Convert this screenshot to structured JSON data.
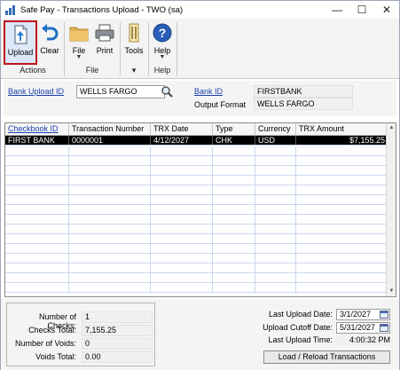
{
  "window": {
    "title": "Safe Pay - Transactions Upload  -  TWO (sa)",
    "minimize_glyph": "—",
    "maximize_glyph": "☐",
    "close_glyph": "✕"
  },
  "ribbon": {
    "upload_label": "Upload",
    "clear_label": "Clear",
    "file_label": "File",
    "print_label": "Print",
    "tools_label": "Tools",
    "help_label": "Help",
    "groups": {
      "actions": "Actions",
      "file": "File",
      "tools": "▾",
      "help": "Help"
    }
  },
  "header": {
    "bank_upload_id_label": "Bank Upload ID",
    "bank_upload_id_value": "WELLS FARGO",
    "bank_id_label": "Bank ID",
    "bank_id_value": "FIRSTBANK",
    "output_format_label": "Output Format",
    "output_format_value": "WELLS FARGO"
  },
  "grid": {
    "columns": [
      "Checkbook ID",
      "Transaction Number",
      "TRX Date",
      "Type",
      "Currency",
      "TRX Amount"
    ],
    "rows": [
      [
        "FIRST BANK",
        "0000001",
        "4/12/2027",
        "CHK",
        "USD",
        "$7,155.25"
      ]
    ]
  },
  "summary": {
    "number_of_checks_label": "Number of Checks:",
    "number_of_checks_value": "1",
    "checks_total_label": "Checks Total:",
    "checks_total_value": "7,155.25",
    "number_of_voids_label": "Number of Voids:",
    "number_of_voids_value": "0",
    "voids_total_label": "Voids Total:",
    "voids_total_value": "0.00"
  },
  "upload_info": {
    "last_upload_date_label": "Last Upload Date:",
    "last_upload_date_value": "3/1/2027",
    "upload_cutoff_date_label": "Upload Cutoff Date:",
    "upload_cutoff_date_value": "5/31/2027",
    "last_upload_time_label": "Last Upload Time:",
    "last_upload_time_value": "4:00:32 PM",
    "load_button_label": "Load / Reload Transactions"
  },
  "colors": {
    "accent_highlight": "#c0141b",
    "link": "#1a3fb0",
    "selected_row": "#000000"
  }
}
